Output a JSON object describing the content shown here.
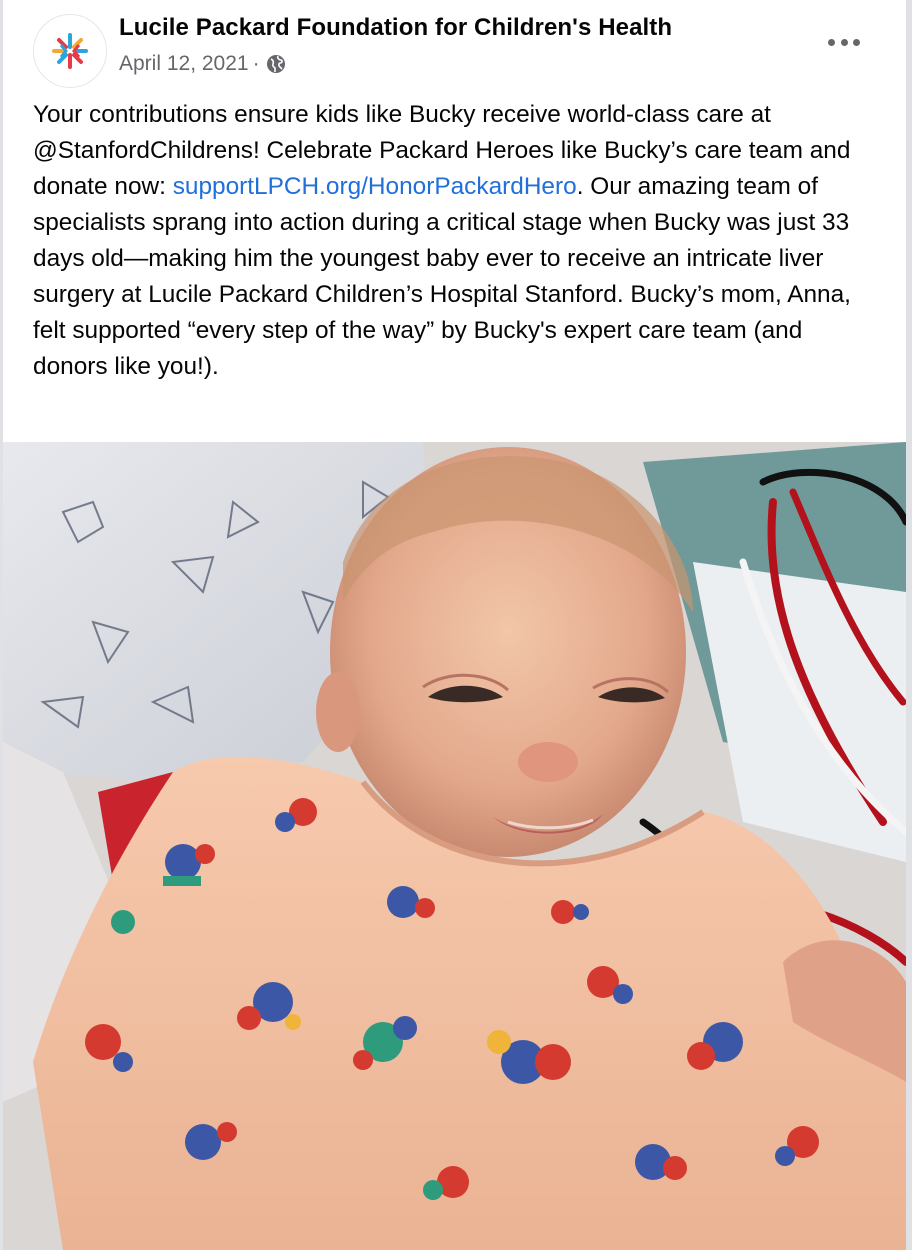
{
  "post": {
    "page_name": "Lucile Packard Foundation for Children's Health",
    "date": "April 12, 2021",
    "separator": "·",
    "privacy_icon": "globe-icon",
    "more_icon": "more-options-icon",
    "body_part1": "Your contributions ensure kids like Bucky receive world-class care at @StanfordChildrens! Celebrate Packard Heroes like Bucky’s care team and donate now: ",
    "link_text": "supportLPCH.org/HonorPackardHero",
    "body_part2": ". Our amazing team of specialists sprang into action during a critical stage when Bucky was just 33 days old—making him the youngest baby ever to receive an intricate liver surgery at Lucile Packard Children’s Hospital Stanford. Bucky’s mom, Anna, felt supported “every step of the way” by Bucky's expert care team (and donors like you!)."
  },
  "colors": {
    "link": "#216fdb",
    "meta": "#65676b",
    "text": "#050505"
  }
}
